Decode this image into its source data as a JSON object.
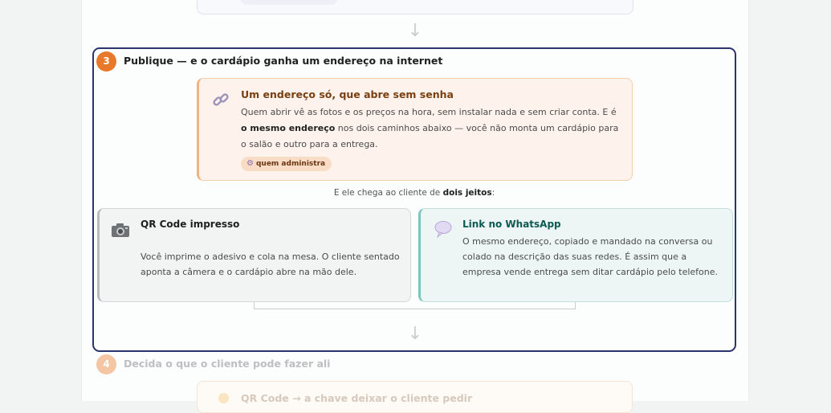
{
  "step3": {
    "number": "3",
    "title": "Publique — e o cardápio ganha um endereço na internet",
    "address_card": {
      "icon": "link-icon",
      "title": "Um endereço só, que abre sem senha",
      "text_part1": "Quem abrir vê as fotos e os preços na hora, sem instalar nada e sem criar conta. E é ",
      "text_bold": "o mesmo endereço",
      "text_part2": " nos dois caminhos abaixo — você não monta um cardápio para o salão e outro para a entrega.",
      "badge_icon": "gear-icon",
      "badge": "quem administra"
    },
    "ways_intro": {
      "prefix": "E ele chega ao cliente de ",
      "bold": "dois jeitos",
      "suffix": ":"
    },
    "ways": {
      "qr": {
        "icon": "camera-icon",
        "title": "QR Code impresso",
        "text": "Você imprime o adesivo e cola na mesa. O cliente sentado aponta a câmera e o cardápio abre na mão dele."
      },
      "whatsapp": {
        "icon": "speech-bubble-icon",
        "title": "Link no WhatsApp",
        "text": "O mesmo endereço, copiado e mandado na conversa ou colado na descrição das suas redes. É assim que a empresa vende entrega sem ditar cardápio pelo telefone."
      }
    }
  },
  "step4": {
    "number": "4",
    "title": "Decida o que o cliente pode fazer ali",
    "next_card_title": "QR Code → a chave deixar o cliente pedir"
  },
  "colors": {
    "step_border": "#2c3470",
    "step_badge": "#e8792a",
    "address_bg": "#fdf3ec",
    "whatsapp_accent": "#7cc7bd"
  }
}
